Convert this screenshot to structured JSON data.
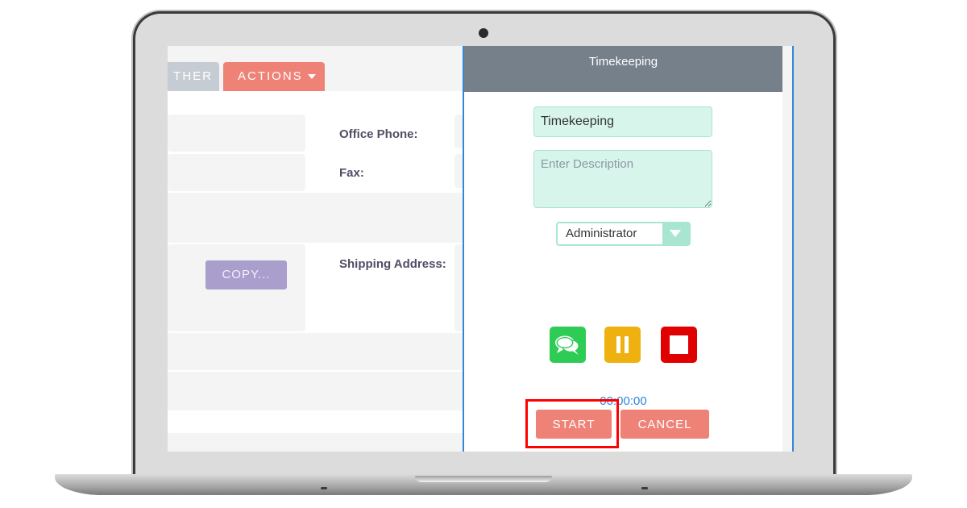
{
  "crm": {
    "tabs": [
      {
        "label": "THER"
      },
      {
        "label": "ACTIONS"
      }
    ],
    "fields": {
      "office_phone_label": "Office Phone:",
      "fax_label": "Fax:",
      "shipping_address_label": "Shipping Address:"
    },
    "copy_button": "COPY..."
  },
  "timekeeping": {
    "title": "Timekeeping",
    "name_value": "Timekeeping",
    "description_placeholder": "Enter Description",
    "user_select": "Administrator",
    "timer": "00:00:00",
    "start_label": "START",
    "cancel_label": "CANCEL",
    "icons": [
      "comments-icon",
      "pause-icon",
      "stop-icon"
    ]
  },
  "colors": {
    "accent_salmon": "#ef8277",
    "header_gray": "#75808a",
    "mint": "#d8f5ec",
    "chat_green": "#2ecc55",
    "pause_yellow": "#efb10f",
    "stop_red": "#e00000",
    "highlight_red": "#ff0000",
    "timer_blue": "#2f86db"
  }
}
